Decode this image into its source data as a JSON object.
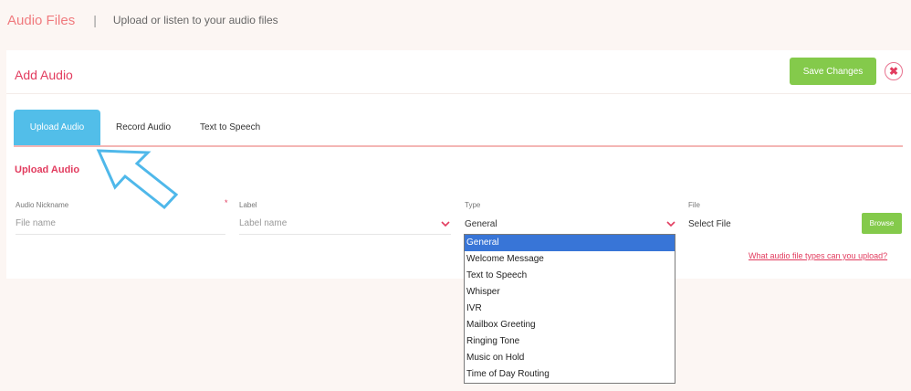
{
  "header": {
    "title": "Audio Files",
    "separator": "|",
    "subtitle": "Upload or listen to your audio files"
  },
  "card": {
    "title": "Add Audio",
    "save_label": "Save Changes",
    "close_symbol": "✖"
  },
  "tabs": [
    {
      "label": "Upload Audio",
      "active": true
    },
    {
      "label": "Record Audio",
      "active": false
    },
    {
      "label": "Text to Speech",
      "active": false
    }
  ],
  "section_title": "Upload Audio",
  "fields": {
    "nickname": {
      "label": "Audio Nickname",
      "placeholder": "File name",
      "required_mark": "*"
    },
    "label": {
      "label": "Label",
      "placeholder": "Label name"
    },
    "type": {
      "label": "Type",
      "value": "General"
    },
    "file": {
      "label": "File",
      "value": "Select File",
      "button": "Browse"
    }
  },
  "help_link": "What audio file types can you upload?",
  "type_options": [
    "General",
    "Welcome Message",
    "Text to Speech",
    "Whisper",
    "IVR",
    "Mailbox Greeting",
    "Ringing Tone",
    "Music on Hold",
    "Time of Day Routing"
  ],
  "colors": {
    "accent": "#e23c5f",
    "tab_active": "#52bee9",
    "button": "#84ca4b",
    "selection": "#3875d7",
    "arrow": "#4fb8ea"
  }
}
